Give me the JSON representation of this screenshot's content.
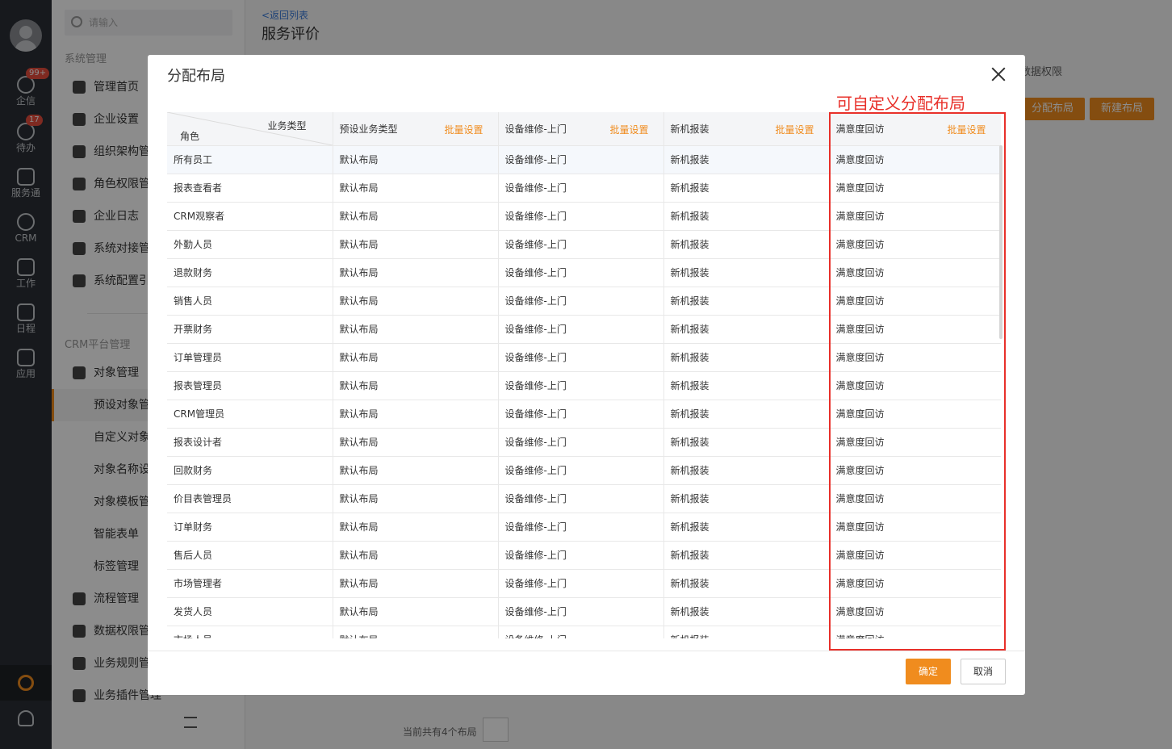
{
  "rail": {
    "items": [
      {
        "label": "企信",
        "badge": "99+"
      },
      {
        "label": "待办",
        "badge": "17"
      },
      {
        "label": "服务通",
        "badge": ""
      },
      {
        "label": "CRM",
        "badge": ""
      },
      {
        "label": "工作",
        "badge": ""
      },
      {
        "label": "日程",
        "badge": ""
      },
      {
        "label": "应用",
        "badge": ""
      }
    ]
  },
  "menu": {
    "search_placeholder": "请输入",
    "group_system": "系统管理",
    "system_items": [
      "管理首页",
      "企业设置",
      "组织架构管",
      "角色权限管",
      "企业日志",
      "系统对接管",
      "系统配置引"
    ],
    "group_crm": "CRM平台管理",
    "crm_items": [
      "对象管理"
    ],
    "sub_items": [
      "预设对象管",
      "自定义对象",
      "对象名称设",
      "对象模板管",
      "智能表单",
      "标签管理"
    ],
    "more_items": [
      "流程管理",
      "数据权限管",
      "业务规则管",
      "业务插件管理"
    ]
  },
  "main": {
    "back_link": "<返回列表",
    "page_title": "服务评价",
    "tab_right": "数据权限",
    "btn_assign": "分配布局",
    "btn_new": "新建布局",
    "footer_text": "当前共有4个布局"
  },
  "modal": {
    "title": "分配布局",
    "header": {
      "diag_top": "业务类型",
      "diag_bottom": "角色",
      "cols": [
        "预设业务类型",
        "设备维修-上门",
        "新机报装",
        "满意度回访"
      ],
      "batch": "批量设置"
    },
    "rows": [
      [
        "所有员工",
        "默认布局",
        "设备维修-上门",
        "新机报装",
        "满意度回访"
      ],
      [
        "报表查看者",
        "默认布局",
        "设备维修-上门",
        "新机报装",
        "满意度回访"
      ],
      [
        "CRM观察者",
        "默认布局",
        "设备维修-上门",
        "新机报装",
        "满意度回访"
      ],
      [
        "外勤人员",
        "默认布局",
        "设备维修-上门",
        "新机报装",
        "满意度回访"
      ],
      [
        "退款财务",
        "默认布局",
        "设备维修-上门",
        "新机报装",
        "满意度回访"
      ],
      [
        "销售人员",
        "默认布局",
        "设备维修-上门",
        "新机报装",
        "满意度回访"
      ],
      [
        "开票财务",
        "默认布局",
        "设备维修-上门",
        "新机报装",
        "满意度回访"
      ],
      [
        "订单管理员",
        "默认布局",
        "设备维修-上门",
        "新机报装",
        "满意度回访"
      ],
      [
        "报表管理员",
        "默认布局",
        "设备维修-上门",
        "新机报装",
        "满意度回访"
      ],
      [
        "CRM管理员",
        "默认布局",
        "设备维修-上门",
        "新机报装",
        "满意度回访"
      ],
      [
        "报表设计者",
        "默认布局",
        "设备维修-上门",
        "新机报装",
        "满意度回访"
      ],
      [
        "回款财务",
        "默认布局",
        "设备维修-上门",
        "新机报装",
        "满意度回访"
      ],
      [
        "价目表管理员",
        "默认布局",
        "设备维修-上门",
        "新机报装",
        "满意度回访"
      ],
      [
        "订单财务",
        "默认布局",
        "设备维修-上门",
        "新机报装",
        "满意度回访"
      ],
      [
        "售后人员",
        "默认布局",
        "设备维修-上门",
        "新机报装",
        "满意度回访"
      ],
      [
        "市场管理者",
        "默认布局",
        "设备维修-上门",
        "新机报装",
        "满意度回访"
      ],
      [
        "发货人员",
        "默认布局",
        "设备维修-上门",
        "新机报装",
        "满意度回访"
      ],
      [
        "市场人员",
        "默认布局",
        "设备维修-上门",
        "新机报装",
        "满意度回访"
      ]
    ],
    "ok_label": "确定",
    "cancel_label": "取消"
  },
  "annotation": {
    "text": "可自定义分配布局",
    "color": "#e8302a"
  },
  "colors": {
    "accent": "#f08c1e",
    "rail_bg": "#2b2f36",
    "link": "#3a7ad9"
  }
}
